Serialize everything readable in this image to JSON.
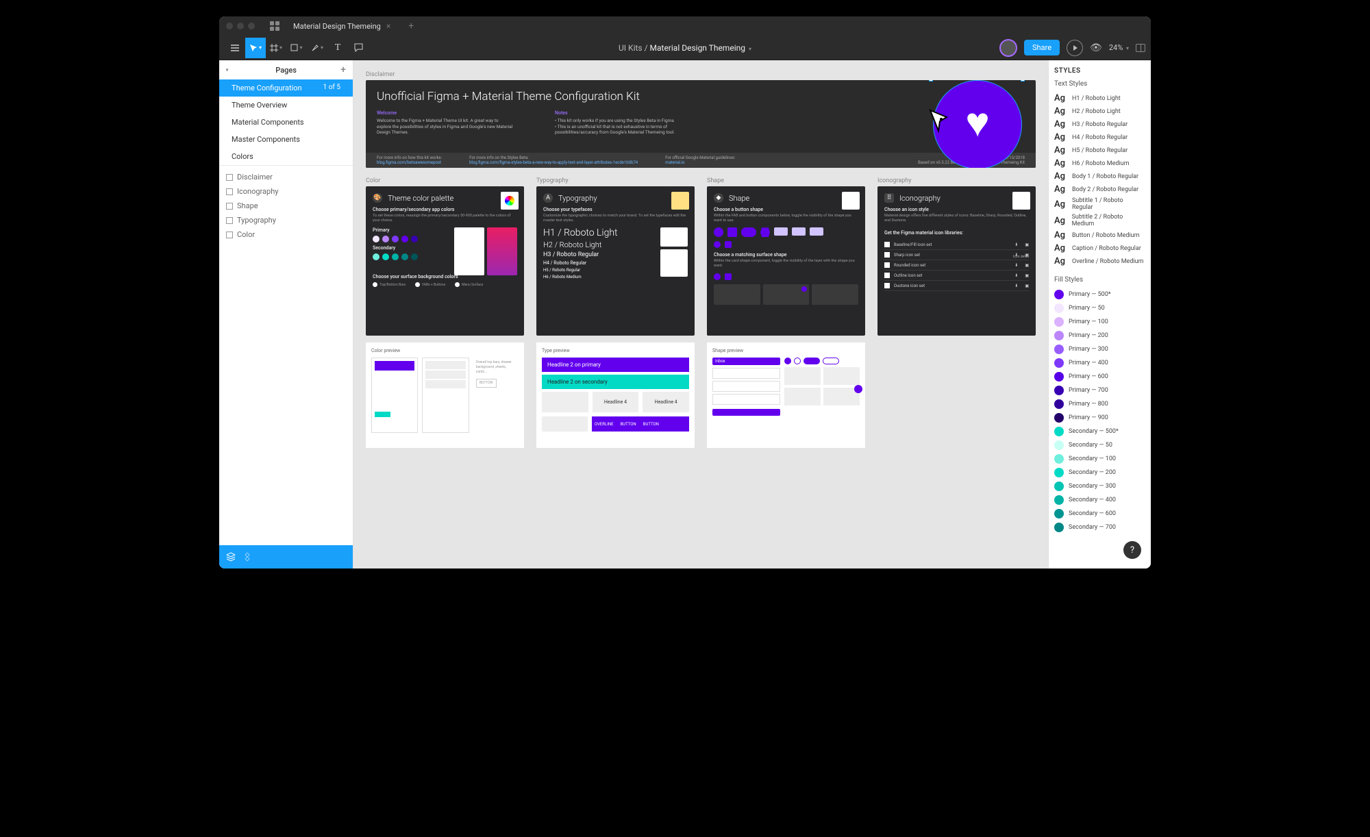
{
  "tab": {
    "title": "Material Design Themeing"
  },
  "toolbar": {
    "zoom": "24%",
    "share": "Share",
    "breadcrumb1": "UI Kits",
    "breadcrumb_sep": " / ",
    "breadcrumb2": "Material Design Themeing"
  },
  "pages": {
    "header": "Pages",
    "items": [
      {
        "name": "Theme Configuration",
        "count": "1 of 5",
        "active": true
      },
      {
        "name": "Theme Overview"
      },
      {
        "name": "Material Components"
      },
      {
        "name": "Master Components"
      },
      {
        "name": "Colors"
      }
    ]
  },
  "layers": [
    "Disclaimer",
    "Iconography",
    "Shape",
    "Typography",
    "Color"
  ],
  "canvas": {
    "disclaimer_label": "Disclaimer",
    "header_title": "Unofficial Figma + Material Theme Configuration Kit",
    "welcome_title": "Welcome",
    "welcome_body": "Welcome to the Figma + Material Theme UI kit. A great way to explore the possibilities of styles in Figma and Google's new Material Design Themes.",
    "notes_title": "Notes",
    "notes_body1": "• This kit only works if you are using the Styles Beta in Figma",
    "notes_body2": "• This is an unofficial kit that is not exhaustive in terms of possibilities/accuracy from Google's Material Themeing tool.",
    "info1_label": "For more info on how this kit works:",
    "info1_link": "blog.figma.com/betoawesomepost",
    "info2_label": "For more info on the Styles Beta:",
    "info2_link": "blog.figma.com/figma-styles-beta-a-new-way-to-apply-text-and-layer-attributes-1ecde1b0b74",
    "info3_label": "For official Google Material guidelines:",
    "info3_link": "material.io",
    "version": "Version 0.5 — 03/10/2018",
    "based_on": "Based on v0.5.22 Beta of the official Material Themeing Kit",
    "columns": {
      "color": {
        "label": "Color",
        "title": "Theme color palette",
        "section1": "Choose primary/secondary app colors",
        "section1_desc": "To set these colors, reassign the primary/secondary 50-900 palette to the colors of your choice.",
        "primary_label": "Primary",
        "secondary_label": "Secondary",
        "section2": "Choose your surface background colors",
        "preview_label": "Color preview"
      },
      "typography": {
        "label": "Typography",
        "title": "Typography",
        "section1": "Choose your typefaces",
        "section1_desc": "Customize the typographic choices to match your brand. To set the typefaces edit the master text styles.",
        "t1": "H1 / Roboto Light",
        "t2": "H2 / Roboto Light",
        "t3": "H3 / Roboto Regular",
        "t4": "H4 / Roboto Regular",
        "t5": "H5 / Roboto Regular",
        "t6": "H6 / Roboto Medium",
        "preview_label": "Type preview",
        "headline_p": "Headline 2 on primary",
        "headline_s": "Headline 2 on secondary"
      },
      "shape": {
        "label": "Shape",
        "title": "Shape",
        "section1": "Choose a button shape",
        "section1_desc": "Within the FAB and button components below, toggle the visibility of the shape you want to use.",
        "section2": "Choose a matching surface shape",
        "section2_desc": "Within the card shape component, toggle the visibility of the layer with the shape you want.",
        "preview_label": "Shape preview"
      },
      "iconography": {
        "label": "Iconography",
        "title": "Iconography",
        "section1": "Choose an icon style",
        "section1_desc": "Material design offers five different styles of icons: Baseline, Sharp, Rounded, Outline, and Duotone.",
        "section2": "Get the Figma material icon libraries:",
        "icon_detail": "Icon detail",
        "icons": [
          "Baseline/Fill icon set",
          "Sharp icon set",
          "Rounded icon set",
          "Outline icon set",
          "Duotone icon set"
        ]
      }
    }
  },
  "styles": {
    "header": "STYLES",
    "text_header": "Text Styles",
    "text_styles": [
      "H1 / Roboto Light",
      "H2 / Roboto Light",
      "H3 / Roboto Regular",
      "H4 / Roboto Regular",
      "H5 / Roboto Regular",
      "H6 / Roboto Medium",
      "Body 1 / Roboto Regular",
      "Body 2 / Roboto Regular",
      "Subtitle 1 / Roboto Regular",
      "Subtitle 2 / Roboto Medium",
      "Button / Roboto Medium",
      "Caption / Roboto Regular",
      "Overline / Roboto Medium"
    ],
    "fill_header": "Fill Styles",
    "fill_styles": [
      {
        "name": "Primary — 500*",
        "color": "#6200ee"
      },
      {
        "name": "Primary — 50",
        "color": "#f2e7fe"
      },
      {
        "name": "Primary — 100",
        "color": "#dbb2ff"
      },
      {
        "name": "Primary — 200",
        "color": "#bb86fc"
      },
      {
        "name": "Primary — 300",
        "color": "#985eff"
      },
      {
        "name": "Primary — 400",
        "color": "#7f39fb"
      },
      {
        "name": "Primary — 600",
        "color": "#5600e8"
      },
      {
        "name": "Primary — 700",
        "color": "#3700b3"
      },
      {
        "name": "Primary — 800",
        "color": "#30009c"
      },
      {
        "name": "Primary — 900",
        "color": "#23036a"
      },
      {
        "name": "Secondary — 500*",
        "color": "#03dac6"
      },
      {
        "name": "Secondary — 50",
        "color": "#c8fff4"
      },
      {
        "name": "Secondary — 100",
        "color": "#70efde"
      },
      {
        "name": "Secondary — 200",
        "color": "#03dac6"
      },
      {
        "name": "Secondary — 300",
        "color": "#00c4b4"
      },
      {
        "name": "Secondary — 400",
        "color": "#00b3a6"
      },
      {
        "name": "Secondary — 600",
        "color": "#019592"
      },
      {
        "name": "Secondary — 700",
        "color": "#018786"
      }
    ]
  },
  "help": "?"
}
